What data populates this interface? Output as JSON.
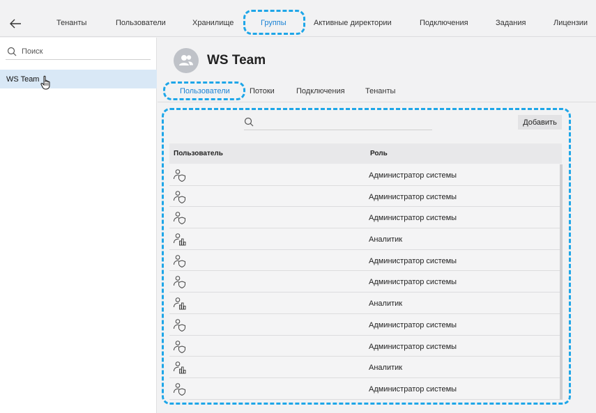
{
  "nav": {
    "tabs": [
      "Тенанты",
      "Пользователи",
      "Хранилище",
      "Группы",
      "Активные директории",
      "Подключения",
      "Задания",
      "Лицензии"
    ],
    "active": "Группы"
  },
  "sidebar": {
    "search_placeholder": "Поиск",
    "items": [
      {
        "label": "WS Team"
      }
    ]
  },
  "group": {
    "title": "WS Team",
    "tabs": [
      "Пользователи",
      "Потоки",
      "Подключения",
      "Тенанты"
    ],
    "active_tab": "Пользователи"
  },
  "table": {
    "add_label": "Добавить",
    "columns": [
      "Пользователь",
      "Роль"
    ],
    "rows": [
      {
        "icon": "user-shield-icon",
        "role": "Администратор системы"
      },
      {
        "icon": "user-shield-icon",
        "role": "Администратор системы"
      },
      {
        "icon": "user-shield-icon",
        "role": "Администратор системы"
      },
      {
        "icon": "user-chart-icon",
        "role": "Аналитик"
      },
      {
        "icon": "user-shield-icon",
        "role": "Администратор системы"
      },
      {
        "icon": "user-shield-icon",
        "role": "Администратор системы"
      },
      {
        "icon": "user-chart-icon",
        "role": "Аналитик"
      },
      {
        "icon": "user-shield-icon",
        "role": "Администратор системы"
      },
      {
        "icon": "user-shield-icon",
        "role": "Администратор системы"
      },
      {
        "icon": "user-chart-icon",
        "role": "Аналитик"
      },
      {
        "icon": "user-shield-icon",
        "role": "Администратор системы"
      }
    ]
  },
  "colors": {
    "accent": "#1a82d4",
    "highlight": "#1ea6e8",
    "selected": "#d9e8f6"
  }
}
